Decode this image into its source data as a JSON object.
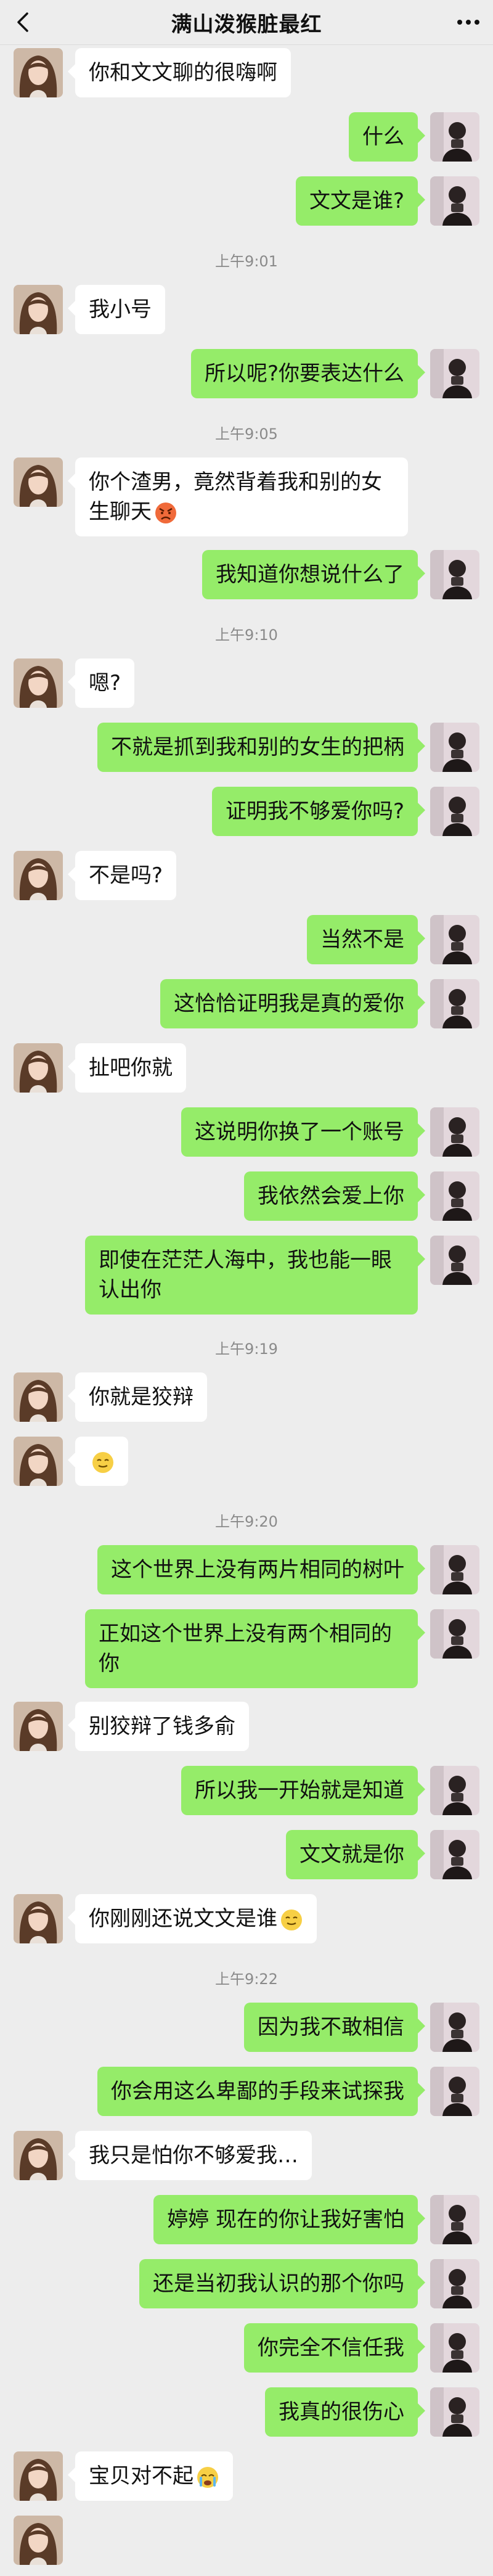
{
  "header": {
    "title": "满山泼猴脏最红"
  },
  "messages": [
    {
      "type": "msg",
      "side": "in",
      "text": "你和文文聊的很嗨啊"
    },
    {
      "type": "msg",
      "side": "out",
      "text": "什么"
    },
    {
      "type": "msg",
      "side": "out",
      "text": "文文是谁?"
    },
    {
      "type": "time",
      "text": "上午9:01"
    },
    {
      "type": "msg",
      "side": "in",
      "text": "我小号"
    },
    {
      "type": "msg",
      "side": "out",
      "text": "所以呢?你要表达什么"
    },
    {
      "type": "time",
      "text": "上午9:05"
    },
    {
      "type": "msg",
      "side": "in",
      "text": "你个渣男，竟然背着我和别的女生聊天",
      "emoji": "angry-face-emoji"
    },
    {
      "type": "msg",
      "side": "out",
      "text": "我知道你想说什么了"
    },
    {
      "type": "time",
      "text": "上午9:10"
    },
    {
      "type": "msg",
      "side": "in",
      "text": "嗯?"
    },
    {
      "type": "msg",
      "side": "out",
      "text": "不就是抓到我和别的女生的把柄"
    },
    {
      "type": "msg",
      "side": "out",
      "text": "证明我不够爱你吗?"
    },
    {
      "type": "msg",
      "side": "in",
      "text": "不是吗?"
    },
    {
      "type": "msg",
      "side": "out",
      "text": "当然不是"
    },
    {
      "type": "msg",
      "side": "out",
      "text": "这恰恰证明我是真的爱你"
    },
    {
      "type": "msg",
      "side": "in",
      "text": "扯吧你就"
    },
    {
      "type": "msg",
      "side": "out",
      "text": "这说明你换了一个账号"
    },
    {
      "type": "msg",
      "side": "out",
      "text": "我依然会爱上你"
    },
    {
      "type": "msg",
      "side": "out",
      "text": "即使在茫茫人海中，我也能一眼认出你"
    },
    {
      "type": "time",
      "text": "上午9:19"
    },
    {
      "type": "msg",
      "side": "in",
      "text": "你就是狡辩"
    },
    {
      "type": "msg",
      "side": "in",
      "text": "",
      "emoji": "smile-face-emoji"
    },
    {
      "type": "time",
      "text": "上午9:20"
    },
    {
      "type": "msg",
      "side": "out",
      "text": "这个世界上没有两片相同的树叶"
    },
    {
      "type": "msg",
      "side": "out",
      "text": "正如这个世界上没有两个相同的你"
    },
    {
      "type": "msg",
      "side": "in",
      "text": "别狡辩了钱多俞"
    },
    {
      "type": "msg",
      "side": "out",
      "text": "所以我一开始就是知道"
    },
    {
      "type": "msg",
      "side": "out",
      "text": "文文就是你"
    },
    {
      "type": "msg",
      "side": "in",
      "text": "你刚刚还说文文是谁",
      "emoji": "smile-face-emoji"
    },
    {
      "type": "time",
      "text": "上午9:22"
    },
    {
      "type": "msg",
      "side": "out",
      "text": "因为我不敢相信"
    },
    {
      "type": "msg",
      "side": "out",
      "text": "你会用这么卑鄙的手段来试探我"
    },
    {
      "type": "msg",
      "side": "in",
      "text": "我只是怕你不够爱我…"
    },
    {
      "type": "msg",
      "side": "out",
      "text": "婷婷 现在的你让我好害怕"
    },
    {
      "type": "msg",
      "side": "out",
      "text": "还是当初我认识的那个你吗"
    },
    {
      "type": "msg",
      "side": "out",
      "text": "你完全不信任我"
    },
    {
      "type": "msg",
      "side": "out",
      "text": "我真的很伤心"
    },
    {
      "type": "msg",
      "side": "in",
      "text": "宝贝对不起",
      "emoji": "crying-face-emoji"
    },
    {
      "type": "msg",
      "side": "in",
      "text": ""
    }
  ]
}
